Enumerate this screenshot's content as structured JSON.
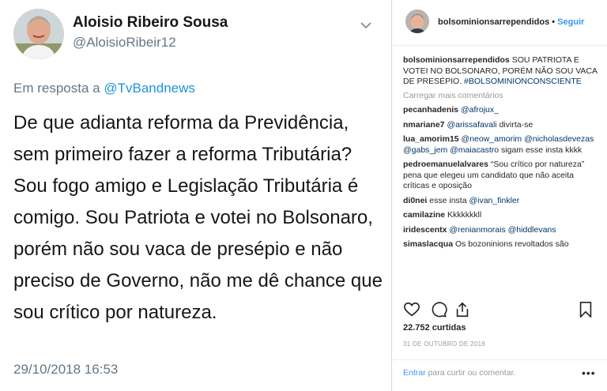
{
  "tweet": {
    "display_name": "Aloisio Ribeiro Sousa",
    "handle": "@AloisioRibeir12",
    "reply_prefix": "Em resposta a",
    "reply_to": "@TvBandnews",
    "text": "De que adianta reforma da Previdência, sem primeiro fazer a reforma Tributária? Sou fogo amigo e Legislação Tributária é comigo. Sou Patriota e votei no Bolsonaro, porém não sou vaca de presépio e não preciso de Governo, não me dê chance que sou crítico por natureza.",
    "timestamp": "29/10/2018 16:53",
    "icons": {
      "menu": "chevron-down-icon",
      "avatar": "avatar"
    }
  },
  "instagram": {
    "username": "bolsominionsarrependidos",
    "separator": "•",
    "follow_label": "Seguir",
    "caption_user": "bolsominionsarrependidos",
    "caption_text": "SOU PATRIOTA E VOTEI NO BOLSONARO, PORÉM NÃO SOU VACA DE PRESÉPIO.",
    "caption_tag": "#BOLSOMINIONCONSCIENTE",
    "load_more": "Carregar mais comentários",
    "comments": [
      {
        "user": "pecanhadenis",
        "mention": "@afrojux_",
        "text": ""
      },
      {
        "user": "nmariane7",
        "mention": "@arissafavali",
        "text": "divirta-se"
      },
      {
        "user": "lua_amorim15",
        "mention": "@neow_amorim @nicholasdevezas @gabs_jem @maiacastro",
        "text": "sigam esse insta kkkk"
      },
      {
        "user": "pedroemanuelalvares",
        "mention": "",
        "text": "“Sou crítico por natureza” pena que elegeu um candidato que não aceita críticas e oposição"
      },
      {
        "user": "di0nei",
        "mention": "@ivan_finkler",
        "text": "esse insta",
        "mention_after": true
      },
      {
        "user": "camilazine",
        "mention": "",
        "text": "Kkkkkkkll"
      },
      {
        "user": "iridescentx",
        "mention": "@renianmorais @hiddlevans",
        "text": ""
      },
      {
        "user": "simaslacqua",
        "mention": "",
        "text": "Os bozoninions revoltados são"
      }
    ],
    "likes": "22.752 curtidas",
    "date": "31 DE OUTUBRO DE 2018",
    "enter_link": "Entrar",
    "enter_text": "para curtir ou comentar.",
    "more_label": "•••",
    "icons": [
      "heart-icon",
      "comment-icon",
      "share-icon",
      "bookmark-icon"
    ],
    "colors": {
      "link": "#3897f0",
      "mention": "#003569",
      "muted": "#999999"
    }
  },
  "colors": {
    "tweet_link": "#1b95e0",
    "tweet_muted": "#657786"
  }
}
